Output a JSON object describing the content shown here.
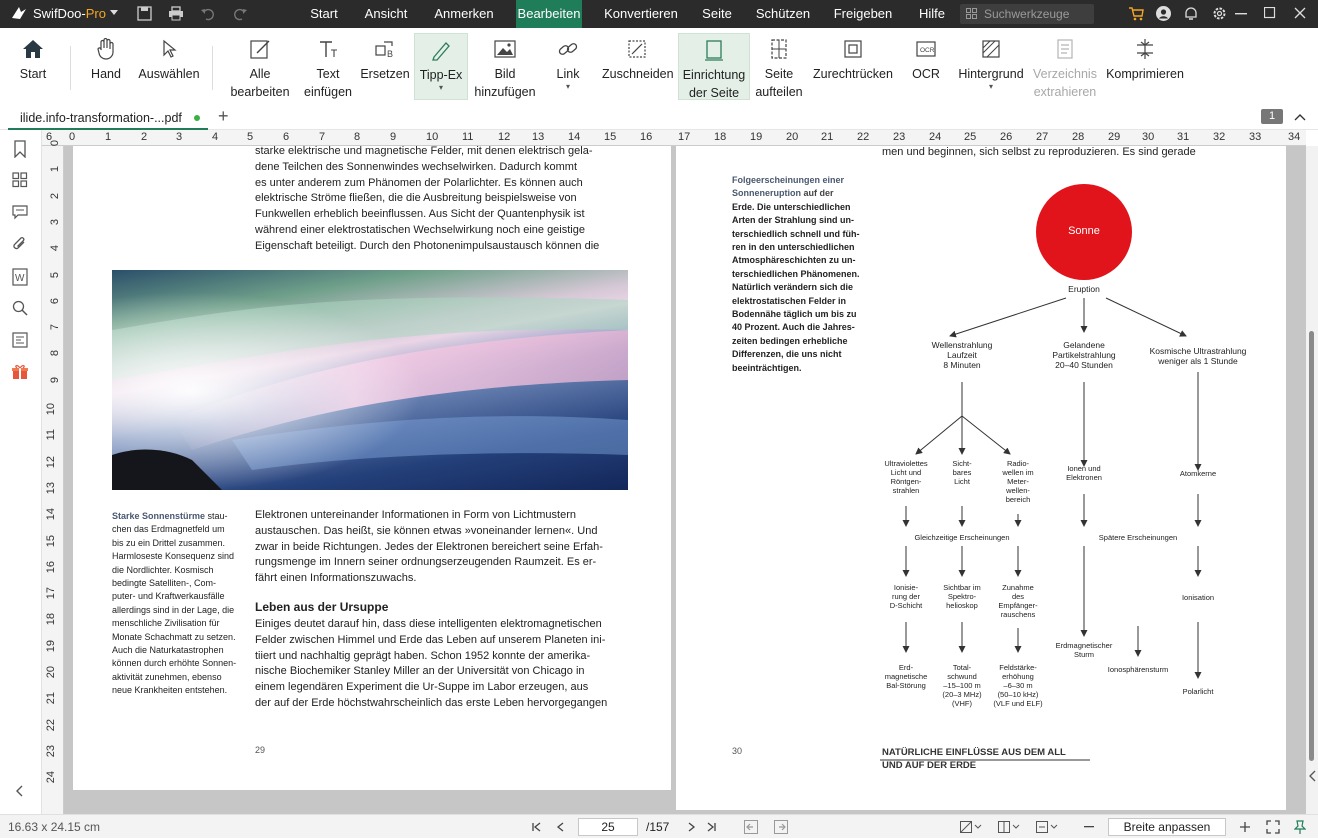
{
  "app": {
    "name": "SwifDoo-",
    "name_suffix": "Pro"
  },
  "menu": {
    "tabs": [
      {
        "label": "Start"
      },
      {
        "label": "Ansicht"
      },
      {
        "label": "Anmerken"
      },
      {
        "label": "Bearbeiten"
      },
      {
        "label": "Konvertieren"
      },
      {
        "label": "Seite"
      },
      {
        "label": "Schützen"
      },
      {
        "label": "Freigeben"
      },
      {
        "label": "Hilfe"
      }
    ],
    "active_tab": "Bearbeiten",
    "search_placeholder": "Suchwerkzeuge"
  },
  "toolbar": {
    "start": "Start",
    "hand": "Hand",
    "select": "Auswählen",
    "edit_all_1": "Alle",
    "edit_all_2": "bearbeiten",
    "text_1": "Text",
    "text_2": "einfügen",
    "replace": "Ersetzen",
    "tippex": "Tipp-Ex",
    "image_1": "Bild",
    "image_2": "hinzufügen",
    "link": "Link",
    "crop": "Zuschneiden",
    "setup_1": "Einrichtung",
    "setup_2": "der Seite",
    "split_1": "Seite",
    "split_2": "aufteilen",
    "straighten": "Zurechtrücken",
    "ocr": "OCR",
    "background": "Hintergrund",
    "extract_1": "Verzeichnis",
    "extract_2": "extrahieren",
    "compress": "Komprimieren"
  },
  "tab": {
    "filename": "ilide.info-transformation-...pdf",
    "page_count_badge": "1"
  },
  "ruler": {
    "h": [
      "6",
      "0",
      "1",
      "2",
      "3",
      "4",
      "5",
      "6",
      "7",
      "8",
      "9",
      "10",
      "11",
      "12",
      "13",
      "14",
      "15",
      "16",
      "17",
      "18",
      "19",
      "20",
      "21",
      "22",
      "23",
      "24",
      "25",
      "26",
      "27",
      "28",
      "29",
      "30",
      "31",
      "32",
      "33",
      "34"
    ],
    "v": [
      "0",
      "1",
      "2",
      "3",
      "4",
      "5",
      "6",
      "7",
      "8",
      "9",
      "10",
      "11",
      "12",
      "13",
      "14",
      "15",
      "16",
      "17",
      "18",
      "19",
      "20",
      "21",
      "22",
      "23",
      "24"
    ]
  },
  "left_page": {
    "body_top": [
      "starke elektrische und magnetische Felder, mit denen elektrisch gela-",
      "dene Teilchen des Sonnenwindes wechselwirken. Dadurch kommt",
      "es unter anderem zum Phänomen der Polarlichter. Es können auch",
      "elektrische Ströme fließen, die die Ausbreitung beispielsweise von",
      "Funkwellen erheblich beeinflussen. Aus Sicht der Quantenphysik ist",
      "während einer elektrostatischen Wechselwirkung noch eine geistige",
      "Eigenschaft beteiligt. Durch den Photonenimpulsaustausch können die"
    ],
    "caption_title": "Starke Sonnenstürme",
    "caption": [
      "stau-",
      "chen das Erdmagnetfeld um",
      "bis zu ein Drittel zusammen.",
      "Harmloseste Konsequenz sind",
      "die Nordlichter. Kosmisch",
      "bedingte Satelliten-, Com-",
      "puter- und Kraftwerkausfälle",
      "allerdings sind in der Lage, die",
      "menschliche Zivilisation für",
      "Monate Schachmatt zu setzen.",
      "Auch die Naturkatastrophen",
      "können durch erhöhte Sonnen-",
      "aktivität zunehmen, ebenso",
      "neue Krankheiten entstehen."
    ],
    "body_mid": [
      "Elektronen untereinander Informationen in Form von Lichtmustern",
      "austauschen. Das heißt, sie können etwas »voneinander lernen«. Und",
      "zwar in beide Richtungen. Jedes der Elektronen bereichert seine Erfah-",
      "rungsmenge im Innern seiner ordnungserzeugenden Raumzeit. Es er-",
      "fährt einen Informationszuwachs."
    ],
    "heading": "Leben aus der Ursuppe",
    "body_bottom": [
      "Einiges deutet darauf hin, dass diese intelligenten elektromagnetischen",
      "Felder zwischen Himmel und Erde das Leben auf unserem Planeten ini-",
      "tiiert und nachhaltig geprägt haben. Schon 1952 konnte der amerika-",
      "nische Biochemiker Stanley Miller an der Universität von Chicago in",
      "einem legendären Experiment die Ur-Suppe im Labor erzeugen, aus",
      "der auf der Erde höchstwahrscheinlich das erste Leben hervorgegangen"
    ],
    "page_number": "29"
  },
  "right_page": {
    "top_line": "men und beginnen, sich selbst zu reproduzieren. Es sind gerade",
    "side_title_1": "Folgeerscheinungen einer",
    "side_title_2": "Sonneneruption",
    "side": [
      "auf der",
      "Erde. Die unterschiedlichen",
      "Arten der Strahlung sind un-",
      "terschiedlich schnell und füh-",
      "ren in den unterschiedlichen",
      "Atmosphäreschichten zu un-",
      "terschiedlichen Phänomenen.",
      "Natürlich verändern sich die",
      "elektrostatischen Felder in",
      "Bodennähe täglich um bis zu",
      "40 Prozent. Auch die Jahres-",
      "zeiten bedingen erhebliche",
      "Differenzen, die uns nicht",
      "beeinträchtigen."
    ],
    "diagram": {
      "sun": "Sonne",
      "eruption": "Eruption",
      "col1": [
        "Wellenstrahlung",
        "Laufzeit",
        "8 Minuten"
      ],
      "col2": [
        "Gelandene",
        "Partikelstrahlung",
        "20–40 Stunden"
      ],
      "col3": [
        "Kosmische Ultrastrahlung",
        "weniger als 1 Stunde"
      ],
      "uv": [
        "Ultraviolettes",
        "Licht und",
        "Röntgen-",
        "strahlen"
      ],
      "visible": [
        "Sicht-",
        "bares",
        "Licht"
      ],
      "radio": [
        "Radio-",
        "wellen im",
        "Meter-",
        "wellen-",
        "bereich"
      ],
      "ions": [
        "Ionen und",
        "Elektronen"
      ],
      "nuclei": "Atomkerne",
      "simultaneous": "Gleichzeitige Erscheinungen",
      "later": "Spätere Erscheinungen",
      "ionize": [
        "Ionisie-",
        "rung der",
        "D-Schicht"
      ],
      "spectro": [
        "Sichtbar im",
        "Spektro-",
        "helioskop"
      ],
      "noise": [
        "Zunahme",
        "des",
        "Empfänger-",
        "rauschens"
      ],
      "ionization": "Ionisation",
      "magstorm": [
        "Erdmagnetischer",
        "Sturm"
      ],
      "ionostorm": "Ionosphärensturm",
      "bal": [
        "Erd-",
        "magnetische",
        "Bal-Störung"
      ],
      "fade": [
        "Total-",
        "schwund",
        "–15–100 m",
        "(20–3 MHz)",
        "(VHF)"
      ],
      "field": [
        "Feldstärke-",
        "erhöhung",
        "–6–30 m",
        "(50–10 kHz)",
        "(VLF und ELF)"
      ],
      "aurora": "Polarlicht"
    },
    "page_number": "30",
    "footer_1": "NATÜRLICHE EINFLÜSSE AUS DEM ALL",
    "footer_2": "UND AUF DER ERDE"
  },
  "status": {
    "dimensions": "16.63 x 24.15 cm",
    "current_page": "25",
    "total_pages": "/157",
    "fit_label": "Breite anpassen"
  },
  "colors": {
    "accent": "#1f7d5a",
    "sun": "#e1141b",
    "titlebar": "#2b2b2b"
  }
}
